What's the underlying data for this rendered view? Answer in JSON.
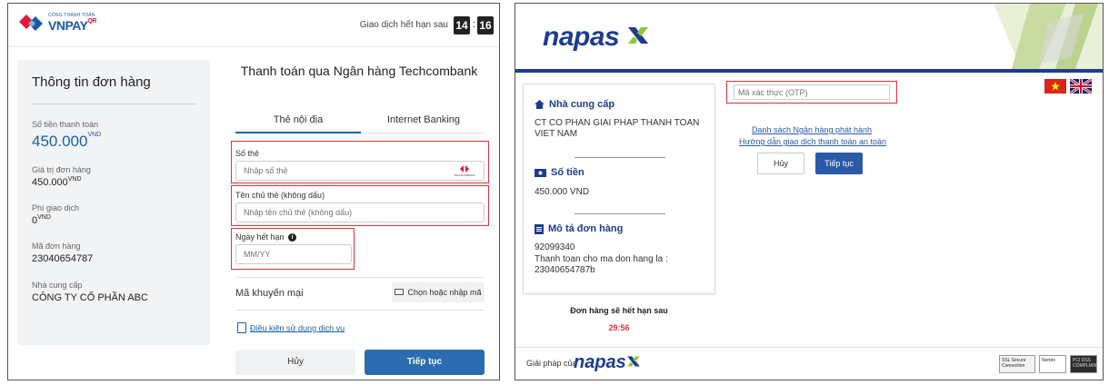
{
  "vnpay": {
    "logo": {
      "small_text": "CỔNG THANH TOÁN",
      "brand": "VNPAY",
      "brand_suffix": "QR"
    },
    "timer": {
      "label": "Giao dịch hết hạn sau",
      "minutes": "14",
      "separator": ":",
      "seconds": "16"
    },
    "order": {
      "title": "Thông tin đơn hàng",
      "amount_label": "Số tiền thanh toán",
      "amount_value": "450.000",
      "amount_currency": "VND",
      "order_value_label": "Giá trị đơn hàng",
      "order_value": "450.000",
      "order_value_currency": "VND",
      "fee_label": "Phí giao dịch",
      "fee_value": "0",
      "fee_currency": "VND",
      "order_id_label": "Mã đơn hàng",
      "order_id": "23040654787",
      "provider_label": "Nhà cung cấp",
      "provider": "CÔNG TY CỔ PHẦN ABC"
    },
    "payment": {
      "title": "Thanh toán qua Ngân hàng Techcombank",
      "tabs": [
        {
          "label": "Thẻ nội địa"
        },
        {
          "label": "Internet Banking"
        }
      ],
      "card_number_label": "Số thẻ",
      "card_number_placeholder": "Nhập số thẻ",
      "bank_icon_text": "TECHCOMBANK",
      "holder_label": "Tên chủ thẻ (không dấu)",
      "holder_placeholder": "Nhập tên chủ thẻ (không dấu)",
      "expiry_label": "Ngày hết hạn",
      "expiry_placeholder": "MM/YY",
      "promo_label": "Mã khuyến mại",
      "promo_button": "Chọn hoặc nhập mã",
      "terms_link": "Điều kiện sử dụng dịch vụ",
      "cancel_button": "Hủy",
      "continue_button": "Tiếp tục"
    }
  },
  "napas": {
    "logo": "napas",
    "provider_heading": "Nhà cung cấp",
    "provider_name": "CT CO PHAN GIAI PHAP THANH TOAN VIET NAM",
    "amount_heading": "Số tiền",
    "amount_value": "450.000 VND",
    "desc_heading": "Mô tả đơn hàng",
    "desc_line1": "92099340",
    "desc_line2": "Thanh toan cho ma don hang la : 23040654787b",
    "expire_label": "Đơn hàng sẽ hết hạn sau",
    "expire_time": "29:56",
    "otp_placeholder": "Mã xác thực (OTP)",
    "link_bank_list": "Danh sách Ngân hàng phát hành",
    "link_guide": "Hướng dẫn giao dịch thanh toán an toàn",
    "cancel_button": "Hủy",
    "continue_button": "Tiếp tục",
    "footer_text": "Giải pháp của",
    "footer_logo": "napas",
    "badges": {
      "ssl": "SSL Secure Connection",
      "norton": "Norton",
      "pci": "PCI DSS COMPLIANT"
    }
  },
  "colors": {
    "vnpay_blue": "#1b5fa8",
    "vnpay_red": "#e31837",
    "napas_blue": "#1d3b8f",
    "highlight_red": "#e0303a",
    "button_blue": "#2b6cb0"
  }
}
